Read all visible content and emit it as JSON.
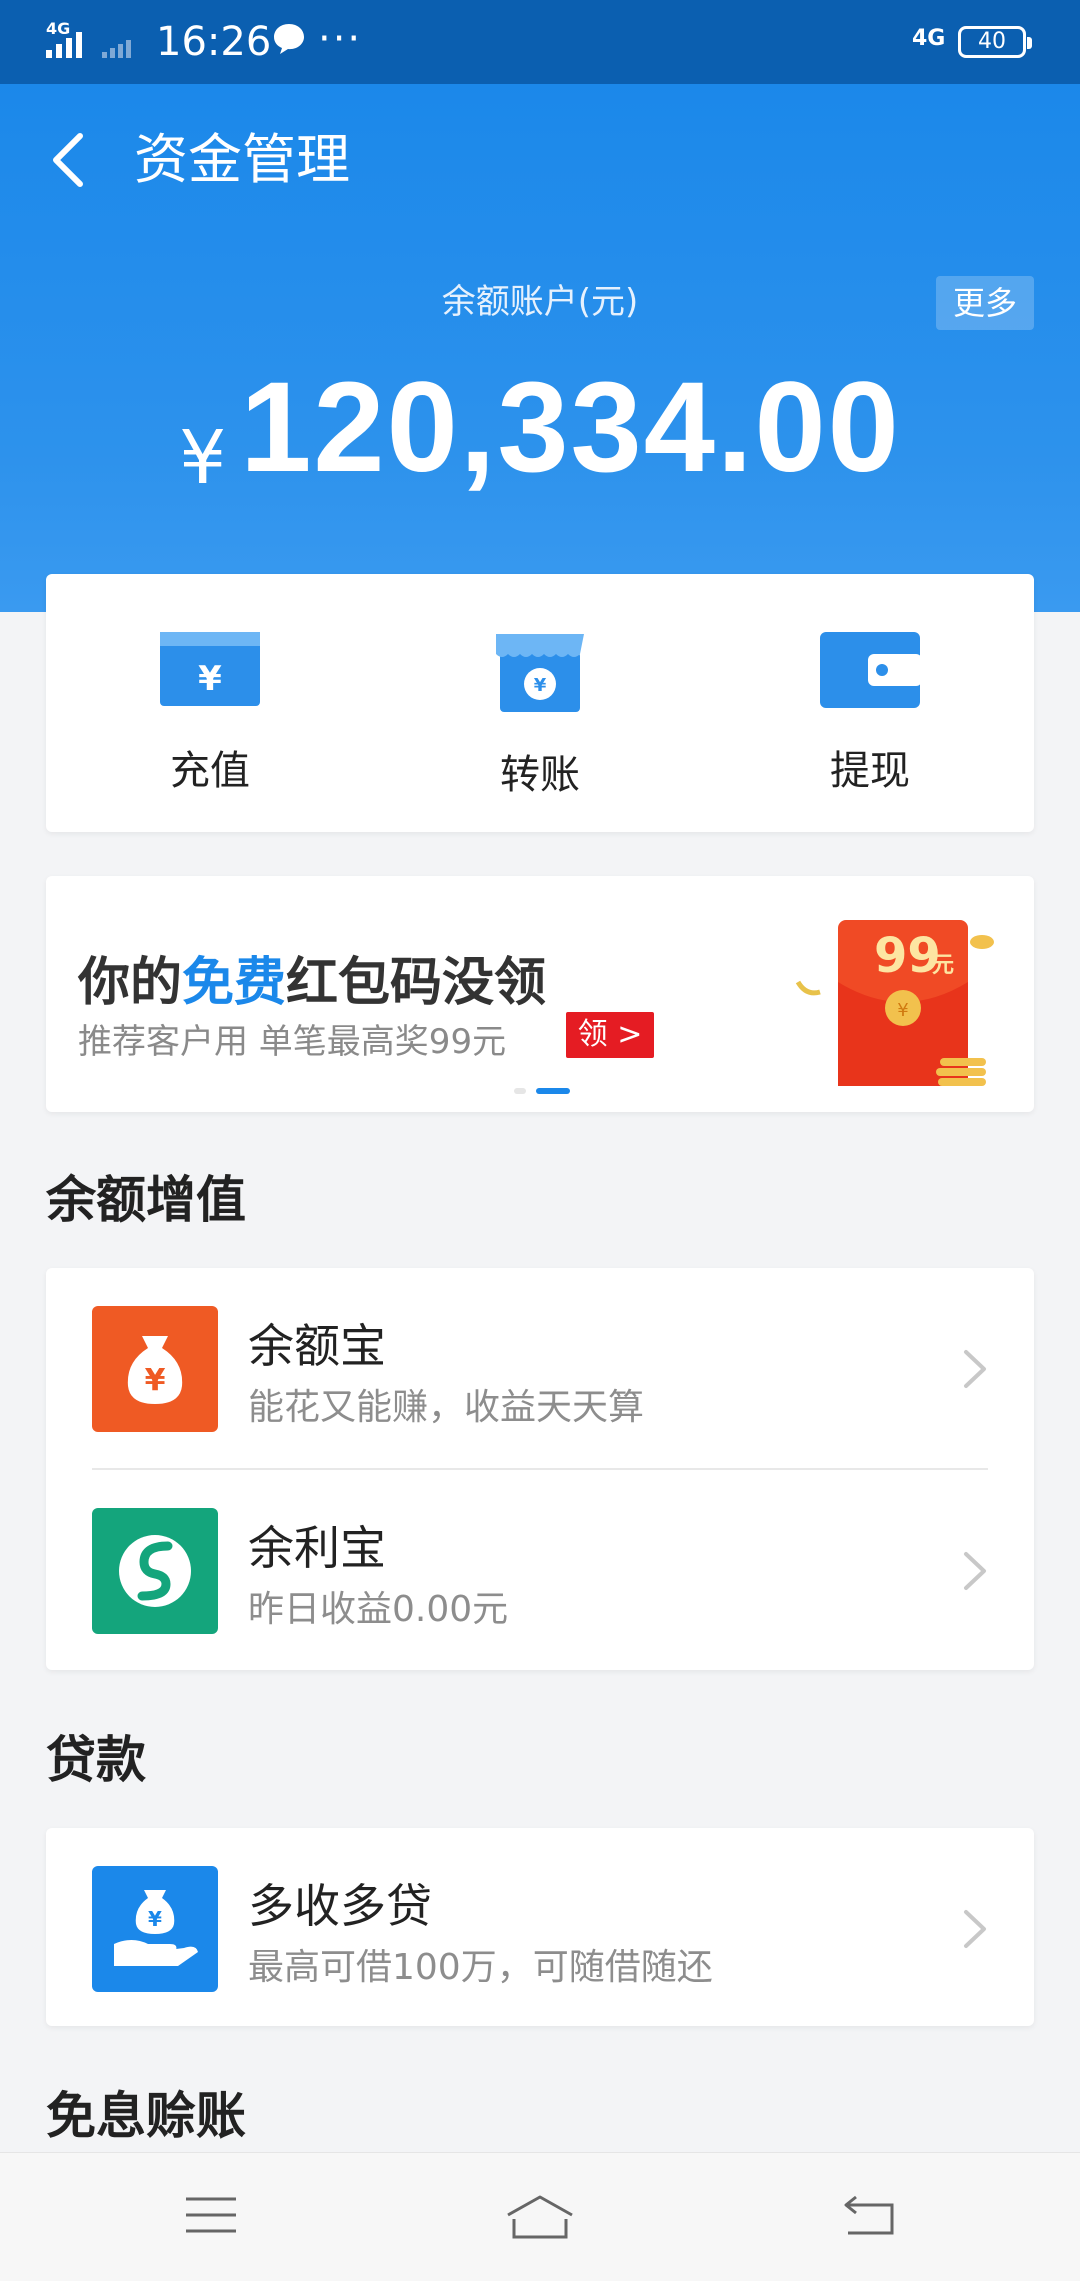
{
  "status_bar": {
    "time": "16:26",
    "network": "4G",
    "battery": "40"
  },
  "header": {
    "title": "资金管理",
    "balance_label": "余额账户(元)",
    "more_label": "更多",
    "currency_symbol": "¥",
    "balance": "120,334.00"
  },
  "actions": [
    {
      "label": "充值",
      "icon": "recharge-card-icon"
    },
    {
      "label": "转账",
      "icon": "transfer-store-icon"
    },
    {
      "label": "提现",
      "icon": "wallet-icon"
    }
  ],
  "banner": {
    "title_prefix": "你的",
    "title_highlight": "免费",
    "title_suffix": "红包码没领",
    "subtitle": "推荐客户用 单笔最高奖99元",
    "button_label": "领 >",
    "envelope_amount": "99",
    "envelope_unit": "元",
    "colors": {
      "highlight": "#1b88ea",
      "button": "#e51c23"
    }
  },
  "sections": {
    "growth_title": "余额增值",
    "loan_title": "贷款",
    "credit_title": "免息赊账"
  },
  "growth_items": [
    {
      "name": "余额宝",
      "desc": "能花又能赚，收益天天算",
      "icon": "money-bag-icon",
      "color": "#ef5a24"
    },
    {
      "name": "余利宝",
      "desc": "昨日收益0.00元",
      "icon": "yulibao-s-icon",
      "color": "#14a57c"
    }
  ],
  "loan_items": [
    {
      "name": "多收多贷",
      "desc": "最高可借100万，可随借随还",
      "icon": "hand-money-icon",
      "color": "#1b88ea"
    }
  ],
  "nav": {
    "menu_icon": "menu-icon",
    "home_icon": "home-icon",
    "back_icon": "back-nav-icon"
  }
}
